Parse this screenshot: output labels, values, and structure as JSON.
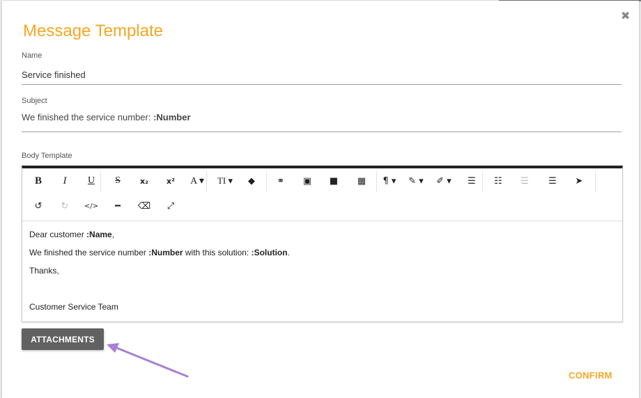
{
  "modal": {
    "title": "Message Template",
    "close_icon": "close-icon"
  },
  "name_field": {
    "label": "Name",
    "value": "Service finished"
  },
  "subject_field": {
    "label": "Subject",
    "prefix": "We finished the service number: ",
    "variable": ":Number"
  },
  "body": {
    "label": "Body Template",
    "toolbar_row1": [
      {
        "name": "bold-button",
        "glyph": "B"
      },
      {
        "name": "italic-button",
        "glyph": "I"
      },
      {
        "name": "underline-button",
        "glyph": "U"
      },
      {
        "name": "strikethrough-button",
        "glyph": "S"
      },
      {
        "name": "subscript-button",
        "glyph": "x₂"
      },
      {
        "name": "superscript-button",
        "glyph": "x²"
      },
      {
        "name": "font-family-dropdown",
        "glyph": "A ▾"
      },
      {
        "name": "font-size-dropdown",
        "glyph": "TI ▾"
      },
      {
        "name": "color-button",
        "glyph": "◆"
      },
      {
        "name": "link-button",
        "glyph": "⚭"
      },
      {
        "name": "image-button",
        "glyph": "▣"
      },
      {
        "name": "video-button",
        "glyph": "■"
      },
      {
        "name": "table-button",
        "glyph": "▦"
      },
      {
        "name": "paragraph-dropdown",
        "glyph": "¶ ▾"
      },
      {
        "name": "style-dropdown",
        "glyph": "✎ ▾"
      },
      {
        "name": "brush-dropdown",
        "glyph": "✐ ▾"
      },
      {
        "name": "ordered-list-button",
        "glyph": "☰"
      },
      {
        "name": "unordered-list-button",
        "glyph": "☷"
      },
      {
        "name": "outdent-button",
        "glyph": "☰"
      },
      {
        "name": "indent-button",
        "glyph": "☰"
      },
      {
        "name": "select-button",
        "glyph": "➤"
      }
    ],
    "toolbar_row2": [
      {
        "name": "undo-button",
        "glyph": "↺"
      },
      {
        "name": "redo-button",
        "glyph": "↻"
      },
      {
        "name": "code-view-button",
        "glyph": "</>"
      },
      {
        "name": "horizontal-rule-button",
        "glyph": "━"
      },
      {
        "name": "eraser-button",
        "glyph": "⌫"
      },
      {
        "name": "fullscreen-button",
        "glyph": "⤢"
      }
    ],
    "lines": [
      {
        "text": "Dear customer ",
        "var": ":Name",
        "tail": ","
      },
      {
        "text": "We finished the service number ",
        "var": ":Number",
        "mid": " with this solution: ",
        "var2": ":Solution",
        "tail": "."
      },
      {
        "text": "Thanks,"
      },
      {
        "text": ""
      },
      {
        "text": "Customer Service Team"
      }
    ]
  },
  "buttons": {
    "attachments": "ATTACHMENTS",
    "confirm": "CONFIRM"
  },
  "colors": {
    "accent": "#f5a623",
    "annotation_arrow": "#a77fd6",
    "button_dark": "#616161"
  }
}
